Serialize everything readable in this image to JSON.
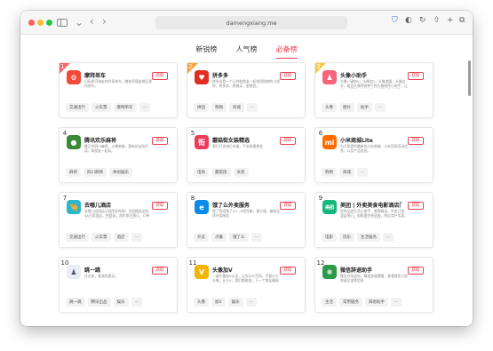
{
  "browser": {
    "url": "damengxiang.me"
  },
  "tabs": [
    {
      "label": "新锐榜",
      "active": false
    },
    {
      "label": "人气榜",
      "active": false
    },
    {
      "label": "必备榜",
      "active": true
    }
  ],
  "colors": {
    "accent": "#e8424f",
    "rank1": "#f4676b",
    "rank2": "#f7a23b",
    "rank3": "#f7c948"
  },
  "apps": [
    {
      "rank": "1",
      "name": "摩拜单车",
      "desc": "扫码即可骑走的共享单车，随处停靠省地区规内停车。",
      "get": "获取",
      "tags": [
        "交通出行",
        "火车票",
        "摩拜单车",
        "..."
      ],
      "logo_color": "#f04a3a",
      "logo_glyph": "⚙"
    },
    {
      "rank": "2",
      "name": "拼多多",
      "desc": "拼多多是一个让你和朋友一起拼团购物的小程序，拼多多，拼着买，更便宜。",
      "get": "获取",
      "tags": [
        "拼团",
        "购物",
        "商城",
        "..."
      ],
      "logo_color": "#e02e24",
      "logo_glyph": "♥"
    },
    {
      "rank": "3",
      "name": "头像小助手",
      "desc": "头像一键加V，头像加1，头像变圆，头像边字，粗丝头像等各种个性头像制作小助手，让你与众不同。个性头像，就用头像小助手。",
      "get": "获取",
      "tags": [
        "头像",
        "图片",
        "助手",
        "..."
      ],
      "logo_color": "#f5657b",
      "logo_glyph": "♟"
    },
    {
      "rank": "4",
      "name": "腾讯欢乐麻将",
      "desc": "最正宗四川麻将，火爆来袭，要有好友陪开局，和朋友一起玩。",
      "get": "获取",
      "tags": [
        "麻将",
        "四川麻将",
        "休闲娱乐"
      ],
      "logo_color": "#3a8a3a",
      "logo_glyph": "●"
    },
    {
      "rank": "5",
      "name": "蘑菇街女装精选",
      "desc": "我们只卖流行衣服，不卖网搜便宜",
      "get": "获取",
      "tags": [
        "电商",
        "蘑菇街",
        "女装"
      ],
      "logo_color": "#ee3b5a",
      "logo_glyph": "街"
    },
    {
      "rank": "6",
      "name": "小米商城Lite",
      "desc": "为大家提供最新的小米商城，小米官网活动信息，以及产品信息。",
      "get": "获取",
      "tags": [
        "购物",
        "商城",
        "..."
      ],
      "logo_color": "#ff6a00",
      "logo_glyph": "mi"
    },
    {
      "rank": "7",
      "name": "去哪儿酒店",
      "desc": "去哪儿网酒店小程序发布啦！为您精选全网48万家酒店，免登录，两步即可预订，订单可随时查看，为您的酒店之旅保驾护航。",
      "get": "获取",
      "tags": [
        "交通出行",
        "火车票",
        "酒店",
        "..."
      ],
      "logo_color": "#2ab7c9",
      "logo_glyph": "🐪"
    },
    {
      "rank": "8",
      "name": "饿了么外卖服务",
      "desc": "饿了我用饿了么！小程序能，更方便，精致品质外卖服务",
      "get": "获取",
      "tags": [
        "外卖",
        "点餐",
        "饿了么",
        "..."
      ],
      "logo_color": "#0a8be8",
      "logo_glyph": "e"
    },
    {
      "rank": "9",
      "name": "美团 | 外卖美食电影酒店门票",
      "desc": "您的品质生活小助手，美食精选，外卖订餐，酒店预订，电影票在线选座，附近商户优惠，美食，电影特价等你来发现",
      "get": "获取",
      "tags": [
        "电影",
        "玩乐",
        "生活服务",
        "..."
      ],
      "logo_color": "#15b679",
      "logo_glyph": "美团"
    },
    {
      "rank": "10",
      "name": "跳一跳",
      "desc": "拉出来，看清的更远。",
      "get": "获取",
      "tags": [
        "跳一跳",
        "腾讯出品",
        "娱乐",
        "..."
      ],
      "logo_color": "#e9edf4",
      "logo_glyph": "♟"
    },
    {
      "rank": "11",
      "name": "头像加V",
      "desc": "一键头像加V认证，让你与众不同。不要什么头像，什么V，我们都能加，下一个朋友圈网红，就是你！",
      "get": "获取",
      "tags": [
        "头像",
        "加V",
        "娱乐",
        "..."
      ],
      "logo_color": "#f5b400",
      "logo_glyph": "V"
    },
    {
      "rank": "12",
      "name": "微信辞退助手",
      "desc": "微信识别追加，精准辞退提醒，查看微信已经辞退及该等信息",
      "get": "获取",
      "tags": [
        "生活",
        "常用服务",
        "辞退助手",
        "..."
      ],
      "logo_color": "#2d9a4a",
      "logo_glyph": "❋"
    }
  ]
}
